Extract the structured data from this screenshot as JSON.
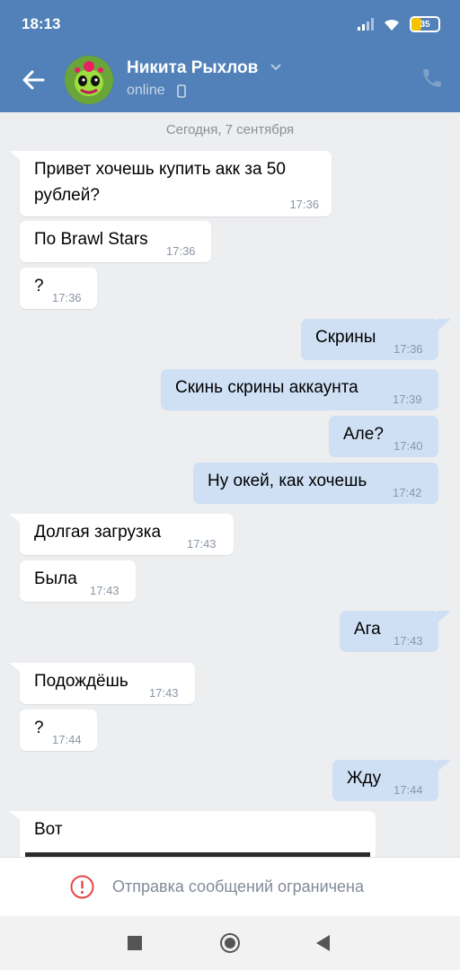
{
  "status_bar": {
    "time": "18:13",
    "battery": "35"
  },
  "header": {
    "contact_name": "Никита Рыхлов",
    "contact_status": "online",
    "icons": {
      "back": "arrow-left-icon",
      "chevron": "chevron-down-icon",
      "mobile": "mobile-phone-icon",
      "call": "phone-icon"
    }
  },
  "chat": {
    "date_separator": "Сегодня, 7 сентября",
    "messages": [
      {
        "dir": "in",
        "line1": "Привет хочешь купить акк за 50",
        "line2": "рублей?",
        "time": "17:36"
      },
      {
        "dir": "in",
        "text": "По Brawl Stars",
        "time": "17:36"
      },
      {
        "dir": "in",
        "text": "?",
        "time": "17:36"
      },
      {
        "dir": "out",
        "text": "Скрины",
        "time": "17:36"
      },
      {
        "dir": "out",
        "text": "Скинь скрины аккаунта",
        "time": "17:39"
      },
      {
        "dir": "out",
        "text": "Але?",
        "time": "17:40"
      },
      {
        "dir": "out",
        "text": "Ну окей, как хочешь",
        "time": "17:42"
      },
      {
        "dir": "in",
        "text": "Долгая загрузка",
        "time": "17:43"
      },
      {
        "dir": "in",
        "text": "Была",
        "time": "17:43"
      },
      {
        "dir": "out",
        "text": "Ага",
        "time": "17:43"
      },
      {
        "dir": "in",
        "text": "Подождёшь",
        "time": "17:43"
      },
      {
        "dir": "in",
        "text": "?",
        "time": "17:44"
      },
      {
        "dir": "out",
        "text": "Жду",
        "time": "17:44"
      },
      {
        "dir": "in",
        "text": "Вот",
        "time": ""
      }
    ]
  },
  "composer": {
    "restriction_text": "Отправка сообщений ограничена",
    "icon": "alert-circle-icon",
    "alert_color": "#e64646"
  },
  "navigation": {
    "icons": [
      "recents-square-icon",
      "home-circle-icon",
      "back-triangle-icon"
    ]
  },
  "colors": {
    "header": "#5181b8",
    "background": "#edeef0",
    "outgoing_bubble": "#cfe0f5",
    "incoming_bubble": "#ffffff"
  }
}
